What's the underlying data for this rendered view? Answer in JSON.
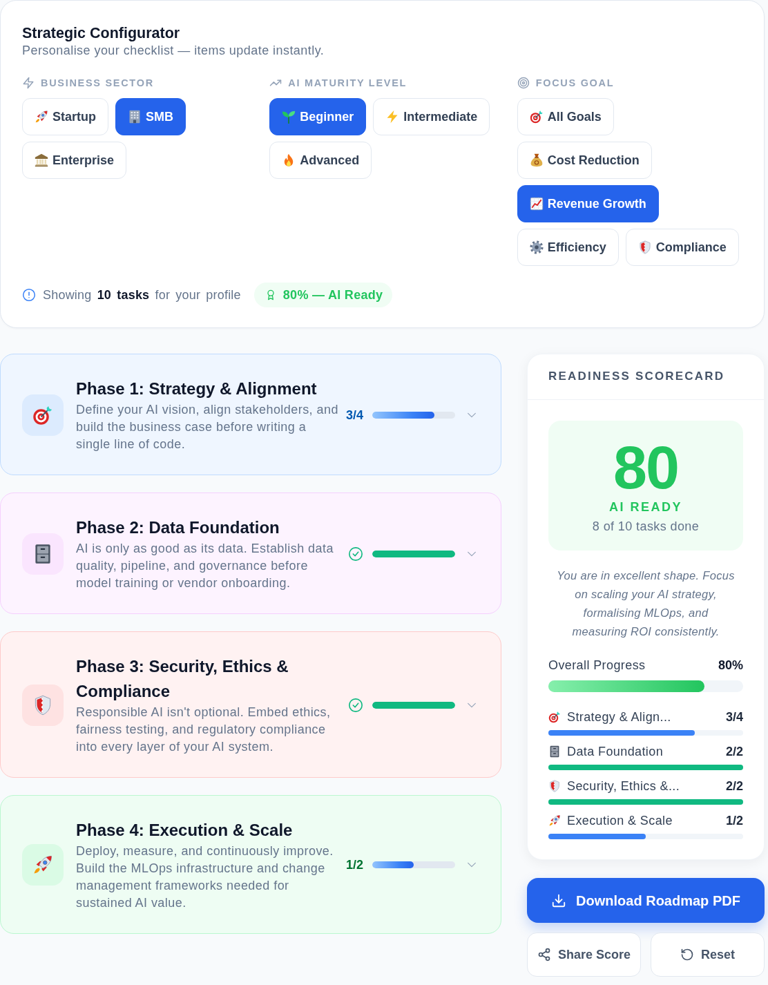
{
  "configurator": {
    "title": "Strategic Configurator",
    "subtitle": "Personalise your checklist — items update instantly.",
    "groups": [
      {
        "label": "BUSINESS SECTOR",
        "options": [
          {
            "label": "Startup",
            "selected": false
          },
          {
            "label": "SMB",
            "selected": true
          },
          {
            "label": "Enterprise",
            "selected": false
          }
        ]
      },
      {
        "label": "AI MATURITY LEVEL",
        "options": [
          {
            "label": "Beginner",
            "selected": true
          },
          {
            "label": "Intermediate",
            "selected": false
          },
          {
            "label": "Advanced",
            "selected": false
          }
        ]
      },
      {
        "label": "FOCUS GOAL",
        "options": [
          {
            "label": "All Goals",
            "selected": false
          },
          {
            "label": "Cost Reduction",
            "selected": false
          },
          {
            "label": "Revenue Growth",
            "selected": true
          },
          {
            "label": "Efficiency",
            "selected": false
          },
          {
            "label": "Compliance",
            "selected": false
          }
        ]
      }
    ],
    "summary": "Showing **10 tasks** for your profile",
    "badge": "80% — AI Ready"
  },
  "phases": [
    {
      "title": "Phase 1: Strategy & Alignment",
      "description": "Define your AI vision, align stakeholders, and build the business case before writing a single line of code.",
      "complete": false,
      "count": "3/4",
      "level": 0.75,
      "expanded": false,
      "color": "#bfdbfe"
    },
    {
      "title": "Phase 2: Data Foundation",
      "description": "AI is only as good as its data. Establish data quality, pipeline, and governance before model training or vendor onboarding.",
      "complete": true,
      "level": 1,
      "expanded": false,
      "color": "#f5d0fe"
    },
    {
      "title": "Phase 3: Security, Ethics & Compliance",
      "description": "Responsible AI isn't optional. Embed ethics, fairness testing, and regulatory compliance into every layer of your AI system.",
      "complete": true,
      "level": 1,
      "expanded": false,
      "color": "#fecaca"
    },
    {
      "title": "Phase 4: Execution & Scale",
      "description": "Deploy, measure, and continuously improve. Build the MLOps infrastructure and change management frameworks needed for sustained AI value.",
      "complete": false,
      "count": "1/2",
      "level": 0.5,
      "expanded": false,
      "color": "#bbf7d0"
    }
  ],
  "scorecard": {
    "title": "READINESS SCORECARD",
    "score": "80",
    "status": "AI READY",
    "tasks": "8 of 10 tasks done",
    "message": "You are in excellent shape. Focus on scaling your AI strategy, formalising MLOps, and measuring ROI consistently.",
    "overall": {
      "label": "Overall Progress",
      "value": "80%",
      "level": 0.8
    },
    "breakdown": [
      {
        "label": "Strategy & Align...",
        "count": "3/4",
        "level": 0.75,
        "complete": false
      },
      {
        "label": "Data Foundation",
        "count": "2/2",
        "level": 1,
        "complete": true
      },
      {
        "label": "Security, Ethics &...",
        "count": "2/2",
        "level": 1,
        "complete": true
      },
      {
        "label": "Execution & Scale",
        "count": "1/2",
        "level": 0.5,
        "complete": false
      }
    ]
  },
  "actions": [
    {
      "kind": "primary",
      "label": "Download Roadmap PDF"
    },
    {
      "kind": "secondary",
      "label": "Share Score"
    },
    {
      "kind": "secondary",
      "label": "Reset"
    }
  ]
}
